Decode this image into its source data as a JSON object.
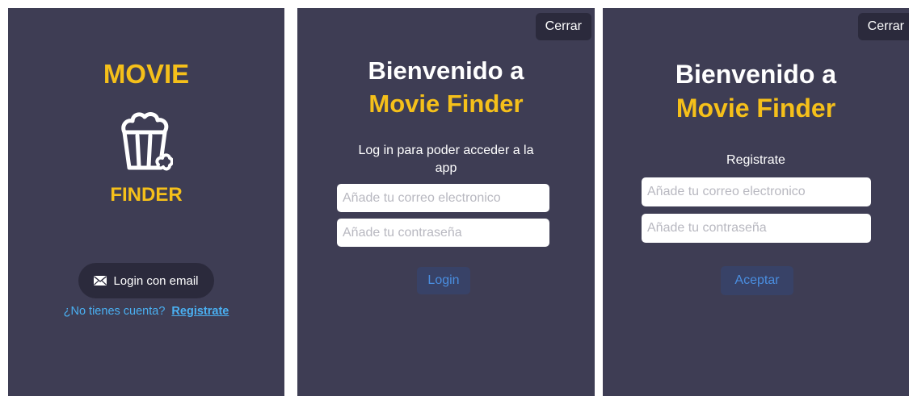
{
  "splash": {
    "logo_top": "MOVIE",
    "logo_bottom": "FINDER",
    "logo_icon": "popcorn-icon",
    "login_email_label": "Login con email",
    "login_email_icon": "mail-icon",
    "no_account_text": "¿No tienes cuenta?",
    "signup_link": "Registrate"
  },
  "login": {
    "close_label": "Cerrar",
    "welcome": "Bienvenido a",
    "brand": "Movie Finder",
    "subtitle": "Log in para poder acceder a la app",
    "email_placeholder": "Añade tu correo electronico",
    "email_value": "",
    "password_placeholder": "Añade tu contraseña",
    "password_value": "",
    "submit_label": "Login"
  },
  "register": {
    "close_label": "Cerrar",
    "welcome": "Bienvenido a",
    "brand": "Movie Finder",
    "subtitle": "Registrate",
    "email_placeholder": "Añade tu correo electronico",
    "email_value": "",
    "password_placeholder": "Añade tu contraseña",
    "password_value": "",
    "submit_label": "Aceptar"
  },
  "colors": {
    "background": "#3e3d54",
    "accent_yellow": "#f5c01a",
    "link_blue": "#4ab0f2",
    "dark_button": "#2b2a3c",
    "action_button": "#384267",
    "action_text": "#4a8ee0"
  }
}
